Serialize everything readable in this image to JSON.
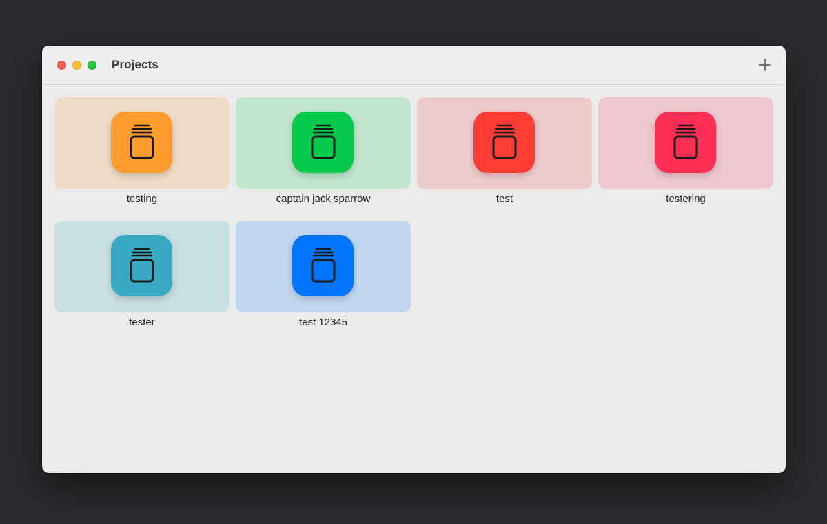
{
  "window": {
    "title": "Projects"
  },
  "toolbar": {
    "add_icon": "plus-icon"
  },
  "projects": [
    {
      "name": "testing",
      "icon": "jar-icon",
      "accent": "#ff9a2e",
      "tint": "#efdcc7"
    },
    {
      "name": "captain jack sparrow",
      "icon": "jar-icon",
      "accent": "#05c94b",
      "tint": "#c1e6cd"
    },
    {
      "name": "test",
      "icon": "jar-icon",
      "accent": "#ff3b35",
      "tint": "#eecbcb"
    },
    {
      "name": "testering",
      "icon": "jar-icon",
      "accent": "#ff2e55",
      "tint": "#eec8d0"
    },
    {
      "name": "tester",
      "icon": "jar-icon",
      "accent": "#38aac4",
      "tint": "#c8dfe3"
    },
    {
      "name": "test 12345",
      "icon": "jar-icon",
      "accent": "#0074fb",
      "tint": "#c1d6ef"
    }
  ]
}
